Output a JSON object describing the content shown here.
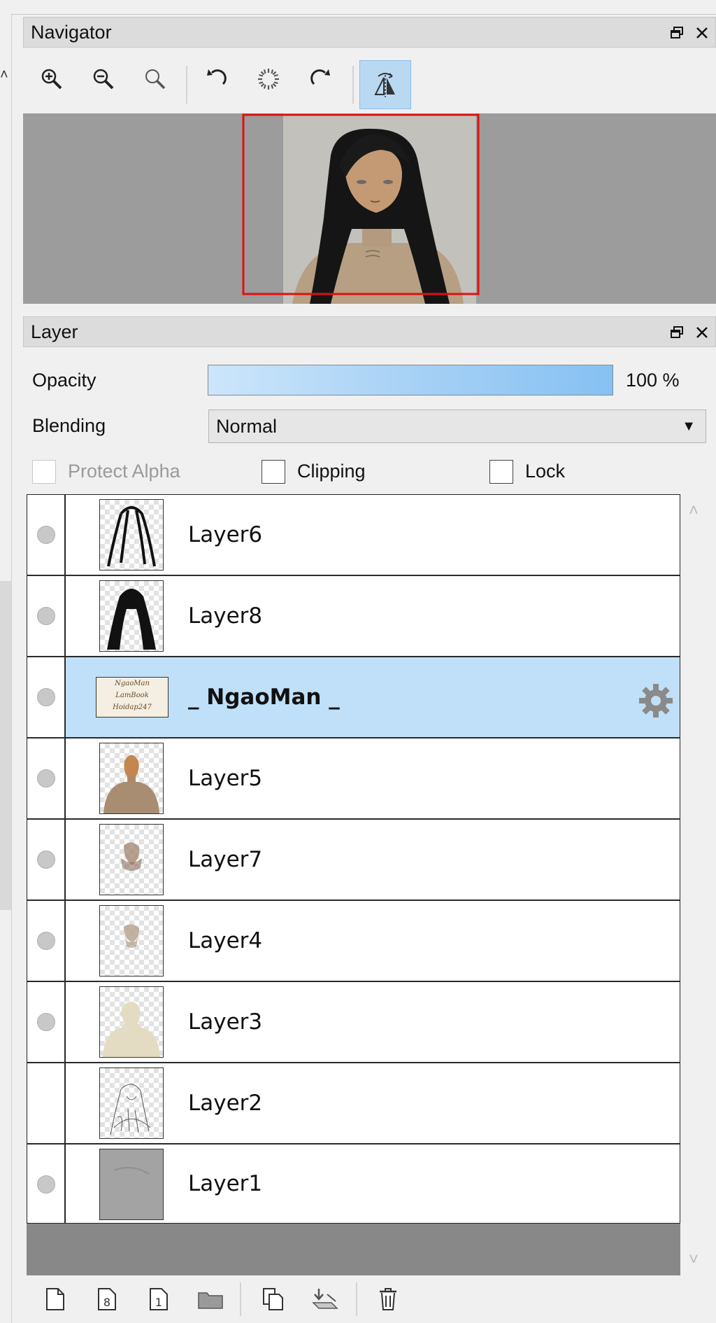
{
  "navigator": {
    "title": "Navigator",
    "toolbar": [
      {
        "name": "zoom-in-icon"
      },
      {
        "name": "zoom-out-icon"
      },
      {
        "name": "zoom-reset-icon"
      },
      {
        "name": "rotate-left-icon"
      },
      {
        "name": "rotate-reset-icon"
      },
      {
        "name": "rotate-right-icon"
      },
      {
        "name": "flip-horizontal-icon",
        "active": true
      }
    ]
  },
  "layer_panel": {
    "title": "Layer",
    "opacity_label": "Opacity",
    "opacity_value": "100 %",
    "opacity_fraction": 1.0,
    "blending_label": "Blending",
    "blending_value": "Normal",
    "protect_alpha_label": "Protect Alpha",
    "clipping_label": "Clipping",
    "lock_label": "Lock",
    "layers": [
      {
        "name": "Layer6",
        "visible_dot": true,
        "thumb": "hair-outline"
      },
      {
        "name": "Layer8",
        "visible_dot": true,
        "thumb": "hair-solid"
      },
      {
        "name": "_ NgaoMan _",
        "visible_dot": true,
        "thumb": "text-signature",
        "selected": true
      },
      {
        "name": "Layer5",
        "visible_dot": true,
        "thumb": "figure-skin"
      },
      {
        "name": "Layer7",
        "visible_dot": true,
        "thumb": "face-shading"
      },
      {
        "name": "Layer4",
        "visible_dot": true,
        "thumb": "face-shading-light"
      },
      {
        "name": "Layer3",
        "visible_dot": true,
        "thumb": "base-cream"
      },
      {
        "name": "Layer2",
        "visible_dot": false,
        "thumb": "sketch"
      },
      {
        "name": "Layer1",
        "visible_dot": true,
        "thumb": "gray-fill"
      }
    ],
    "thumb_signature_lines": [
      "NgaoMan",
      "LamBook",
      "Hoidap247"
    ],
    "bottom_toolbar": [
      "new-layer-icon",
      "new-8bit-layer-icon",
      "new-1bit-layer-icon",
      "new-folder-icon",
      "duplicate-layer-icon",
      "merge-down-icon",
      "delete-layer-icon"
    ]
  },
  "colors": {
    "selection_row": "#bfe0f8",
    "opacity_bar": "#86c1f3",
    "viewport_frame": "#e01010",
    "panel_header": "#dcdcdc"
  }
}
